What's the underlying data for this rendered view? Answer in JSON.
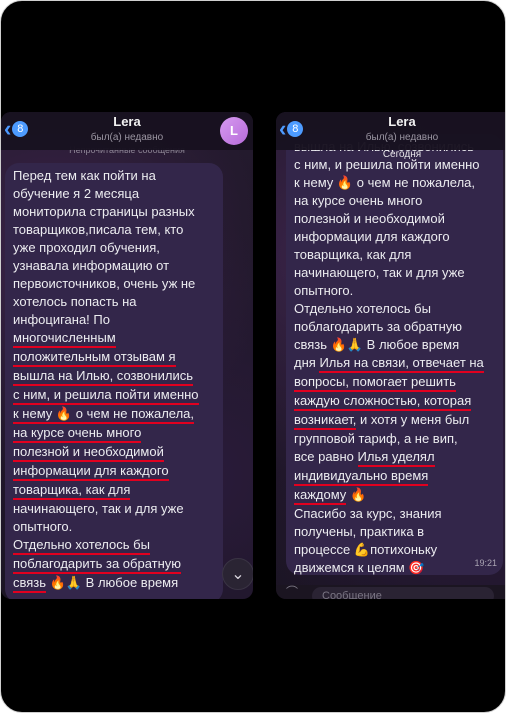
{
  "left": {
    "header": {
      "back_count": "8",
      "name": "Lera",
      "status": "был(а) недавно",
      "avatar_letter": "L"
    },
    "ghost_text": "Непрочитанные сообщения",
    "lines": [
      "Перед тем как пойти на",
      "обучение я 2 месяца",
      "мониторила страницы разных",
      "товарщиков,писала тем, кто",
      "уже  проходил обучения,",
      "узнавала информацию от",
      "первоисточников, очень уж не",
      "хотелось попасть на",
      "инфоцигана! По",
      "многочисленным",
      "положительным отзывам я",
      "вышла на Илью, созвонились",
      "с ним, и решила пойти именно",
      "к нему",
      "о чем не пожалела,",
      "на курсе очень много",
      "полезной и необходимой",
      "информации для каждого",
      "товарщика, как для",
      "начинающего, так и для уже",
      "опытного.",
      "Отдельно хотелось бы",
      "поблагодарить за обратную",
      "связь",
      "В любое время"
    ]
  },
  "right": {
    "header": {
      "back_count": "8",
      "name": "Lera",
      "status": "был(а) недавно"
    },
    "date_divider": "Сегодня",
    "time": "19:21",
    "input_placeholder": "Сообщение",
    "lines": [
      "вышла на Илью, созвонились",
      "с ним, и решила пойти именно",
      "к нему",
      "о чем не пожалела,",
      "на курсе очень много",
      "полезной и необходимой",
      "информации для каждого",
      "товарщика, как для",
      "начинающего, так и для уже",
      "опытного.",
      "Отдельно хотелось бы",
      "поблагодарить за обратную",
      "связь",
      "В любое время",
      "дня",
      "Илья на связи, отвечает на",
      "вопросы, помогает решить",
      "каждую сложностью, которая",
      "возникает,",
      "и хотя у меня был",
      "групповой тариф, а не вип,",
      "все равно",
      "Илья уделял",
      "индивидуально время",
      "каждому",
      "Спасибо за курс, знания",
      "получены, практика в",
      "процессе",
      "потихоньку",
      "движемся к целям"
    ]
  },
  "emoji": {
    "fire": "🔥",
    "pray": "🙏",
    "muscle": "💪",
    "target": "🎯"
  },
  "icons": {
    "back": "chevron-left-icon",
    "scroll_down": "chevron-down-icon",
    "attach": "paperclip-icon",
    "mic": "microphone-icon"
  }
}
